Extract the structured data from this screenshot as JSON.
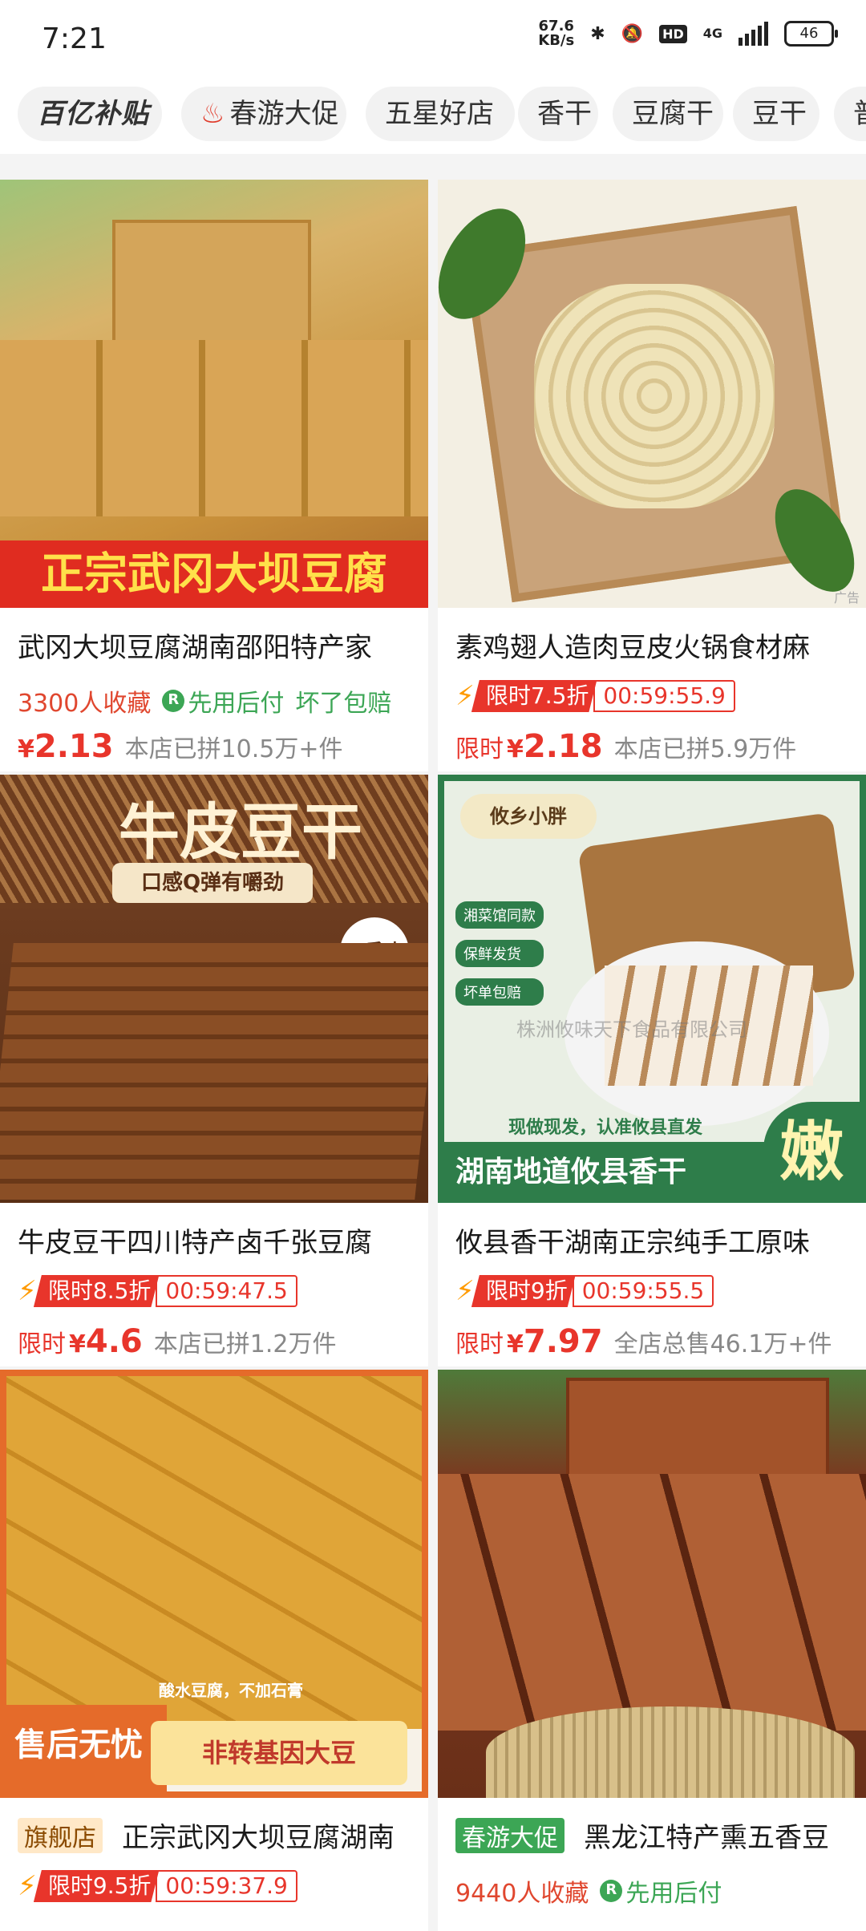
{
  "status_bar": {
    "time": "7:21",
    "speed": "67.6",
    "speed_unit": "KB/s",
    "network": "4G",
    "battery": "46"
  },
  "tabs": [
    {
      "label": "百亿补贴"
    },
    {
      "label": "春游大促"
    },
    {
      "label": "五星好店"
    },
    {
      "label": "香干"
    },
    {
      "label": "豆腐干"
    },
    {
      "label": "豆干"
    },
    {
      "label": "普"
    }
  ],
  "products": [
    {
      "image_text": "正宗武冈大坝豆腐",
      "title": "武冈大坝豆腐湖南邵阳特产家",
      "favorites": "3300人收藏",
      "pay_later": "先用后付",
      "refund": "坏了包赔",
      "price_prefix": "",
      "price": "2.13",
      "sold": "本店已拼10.5万+件"
    },
    {
      "title": "素鸡翅人造肉豆皮火锅食材麻",
      "flash_label": "限时7.5折",
      "countdown": "00:59:55.9",
      "price_prefix": "限时",
      "price": "2.18",
      "sold": "本店已拼5.9万件",
      "ad_label": "广告"
    },
    {
      "image_text": "牛皮豆干",
      "image_sub": "口感Q弹有嚼劲",
      "image_badge": "五香味",
      "title": "牛皮豆干四川特产卤千张豆腐",
      "flash_label": "限时8.5折",
      "countdown": "00:59:47.5",
      "price_prefix": "限时",
      "price": "4.6",
      "sold": "本店已拼1.2万件"
    },
    {
      "image_brand": "攸乡小胖",
      "image_badges": [
        "湘菜馆同款",
        "保鲜发货",
        "坏单包赔"
      ],
      "image_watermark": "株洲攸味天下食品有限公司",
      "image_note": "现做现发，认准攸县直发",
      "image_text": "湖南地道攸县香干",
      "image_big": "嫩",
      "title": "攸县香干湖南正宗纯手工原味",
      "flash_label": "限时9折",
      "countdown": "00:59:55.5",
      "price_prefix": "限时",
      "price": "7.97",
      "sold": "全店总售46.1万+件"
    },
    {
      "image_note": "酸水豆腐，不加石膏",
      "image_text": "售后无忧",
      "image_sub": "非转基因大豆",
      "shop_tag": "旗舰店",
      "title": "正宗武冈大坝豆腐湖南",
      "flash_label": "限时9.5折",
      "countdown": "00:59:37.9"
    },
    {
      "shop_tag": "春游大促",
      "title": "黑龙江特产熏五香豆",
      "favorites": "9440人收藏",
      "pay_later": "先用后付"
    }
  ],
  "colors": {
    "accent": "#e8352b",
    "green": "#3ca655"
  }
}
